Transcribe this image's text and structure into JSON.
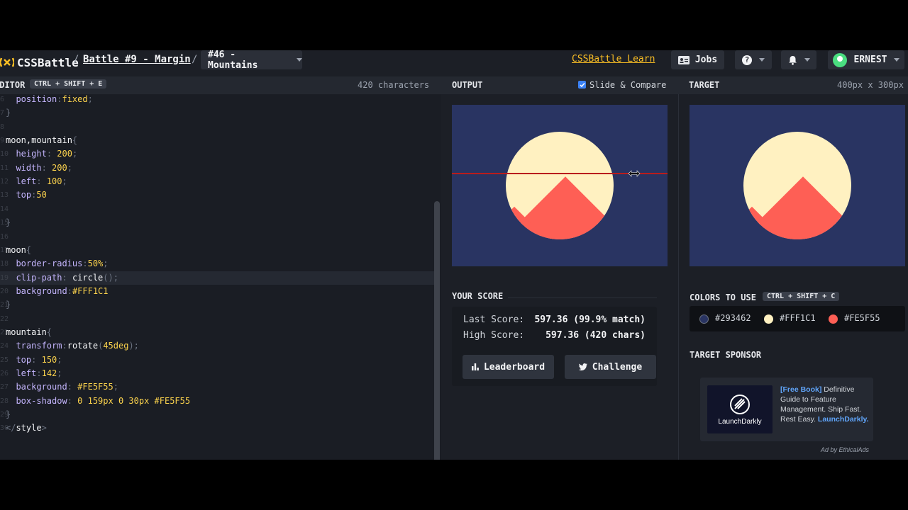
{
  "nav": {
    "logo": "CSSBattle",
    "separator": "/",
    "battle": "Battle #9 - Margin",
    "target": "#46 - Mountains",
    "learn": "CSSBattle Learn",
    "jobs": "Jobs",
    "help": "?",
    "user": "ERNEST"
  },
  "editor": {
    "title": "EDITOR",
    "shortcut": "CTRL + SHIFT + E",
    "char_count": "420 characters",
    "lines": [
      {
        "n": "6",
        "parts": [
          [
            "punct",
            "  "
          ],
          [
            "prop",
            "position"
          ],
          [
            "punct",
            ":"
          ],
          [
            "val",
            "fixed"
          ],
          [
            "punct",
            ";"
          ]
        ]
      },
      {
        "n": "7",
        "parts": [
          [
            "punct",
            "}"
          ]
        ]
      },
      {
        "n": "8",
        "parts": []
      },
      {
        "n": "9",
        "parts": [
          [
            "sel",
            "moon,mountain"
          ],
          [
            "punct",
            "{"
          ]
        ]
      },
      {
        "n": "10",
        "parts": [
          [
            "punct",
            "  "
          ],
          [
            "prop",
            "height"
          ],
          [
            "punct",
            ": "
          ],
          [
            "val",
            "200"
          ],
          [
            "punct",
            ";"
          ]
        ]
      },
      {
        "n": "11",
        "parts": [
          [
            "punct",
            "  "
          ],
          [
            "prop",
            "width"
          ],
          [
            "punct",
            ": "
          ],
          [
            "val",
            "200"
          ],
          [
            "punct",
            ";"
          ]
        ]
      },
      {
        "n": "12",
        "parts": [
          [
            "punct",
            "  "
          ],
          [
            "prop",
            "left"
          ],
          [
            "punct",
            ": "
          ],
          [
            "val",
            "100"
          ],
          [
            "punct",
            ";"
          ]
        ]
      },
      {
        "n": "13",
        "parts": [
          [
            "punct",
            "  "
          ],
          [
            "prop",
            "top"
          ],
          [
            "punct",
            ":"
          ],
          [
            "val",
            "50"
          ]
        ]
      },
      {
        "n": "14",
        "parts": []
      },
      {
        "n": "15",
        "parts": [
          [
            "punct",
            "}"
          ]
        ]
      },
      {
        "n": "16",
        "parts": []
      },
      {
        "n": "17",
        "parts": [
          [
            "sel",
            "moon"
          ],
          [
            "punct",
            "{"
          ]
        ]
      },
      {
        "n": "18",
        "parts": [
          [
            "punct",
            "  "
          ],
          [
            "prop",
            "border-radius"
          ],
          [
            "punct",
            ":"
          ],
          [
            "val",
            "50%"
          ],
          [
            "punct",
            ";"
          ]
        ]
      },
      {
        "n": "19",
        "parts": [
          [
            "punct",
            "  "
          ],
          [
            "prop",
            "clip-path"
          ],
          [
            "punct",
            ": "
          ],
          [
            "sel",
            "circle"
          ],
          [
            "punct",
            "();"
          ]
        ]
      },
      {
        "n": "20",
        "parts": [
          [
            "punct",
            "  "
          ],
          [
            "prop",
            "background"
          ],
          [
            "punct",
            ":"
          ],
          [
            "val",
            "#FFF1C1"
          ]
        ]
      },
      {
        "n": "21",
        "parts": [
          [
            "punct",
            "}"
          ]
        ]
      },
      {
        "n": "22",
        "parts": []
      },
      {
        "n": "23",
        "parts": [
          [
            "sel",
            "mountain"
          ],
          [
            "punct",
            "{"
          ]
        ]
      },
      {
        "n": "24",
        "parts": [
          [
            "punct",
            "  "
          ],
          [
            "prop",
            "transform"
          ],
          [
            "punct",
            ":"
          ],
          [
            "sel",
            "rotate"
          ],
          [
            "punct",
            "("
          ],
          [
            "val",
            "45deg"
          ],
          [
            "punct",
            ");"
          ]
        ]
      },
      {
        "n": "25",
        "parts": [
          [
            "punct",
            "  "
          ],
          [
            "prop",
            "top"
          ],
          [
            "punct",
            ": "
          ],
          [
            "val",
            "150"
          ],
          [
            "punct",
            ";"
          ]
        ]
      },
      {
        "n": "26",
        "parts": [
          [
            "punct",
            "  "
          ],
          [
            "prop",
            "left"
          ],
          [
            "punct",
            ":"
          ],
          [
            "val",
            "142"
          ],
          [
            "punct",
            ";"
          ]
        ]
      },
      {
        "n": "27",
        "parts": [
          [
            "punct",
            "  "
          ],
          [
            "prop",
            "background"
          ],
          [
            "punct",
            ": "
          ],
          [
            "val",
            "#FE5F55"
          ],
          [
            "punct",
            ";"
          ]
        ]
      },
      {
        "n": "28",
        "parts": [
          [
            "punct",
            "  "
          ],
          [
            "prop",
            "box-shadow"
          ],
          [
            "punct",
            ": "
          ],
          [
            "val",
            "0 159px 0 30px #FE5F55"
          ]
        ]
      },
      {
        "n": "29",
        "parts": [
          [
            "punct",
            "}"
          ]
        ]
      },
      {
        "n": "30",
        "parts": [
          [
            "punct",
            "</"
          ],
          [
            "sel",
            "style"
          ],
          [
            "punct",
            ">"
          ]
        ]
      }
    ]
  },
  "output": {
    "title": "OUTPUT",
    "slide_compare": "Slide & Compare",
    "slide_checked": true
  },
  "target_panel": {
    "title": "TARGET",
    "size": "400px x 300px"
  },
  "score": {
    "title": "YOUR SCORE",
    "last_label": "Last Score:",
    "last_value": "597.36 (99.9% match)",
    "high_label": "High Score:",
    "high_value": "597.36 (420 chars)",
    "leaderboard": "Leaderboard",
    "challenge": "Challenge"
  },
  "colors": {
    "title": "COLORS TO USE",
    "shortcut": "CTRL + SHIFT + C",
    "items": [
      {
        "hex": "#293462"
      },
      {
        "hex": "#FFF1C1"
      },
      {
        "hex": "#FE5F55"
      }
    ]
  },
  "sponsor": {
    "title": "TARGET SPONSOR",
    "logo_text": "LaunchDarkly",
    "tag": "[Free Book]",
    "text": " Definitive Guide to Feature Management. Ship Fast. Rest Easy. ",
    "brand": "LaunchDarkly.",
    "ad_note": "Ad by EthicalAds"
  },
  "theme": {
    "accent": "#fbbf24",
    "art_bg": "#293462",
    "art_moon": "#FFF1C1",
    "art_mountain": "#FE5F55",
    "primary_button": "#1d4ed8"
  }
}
